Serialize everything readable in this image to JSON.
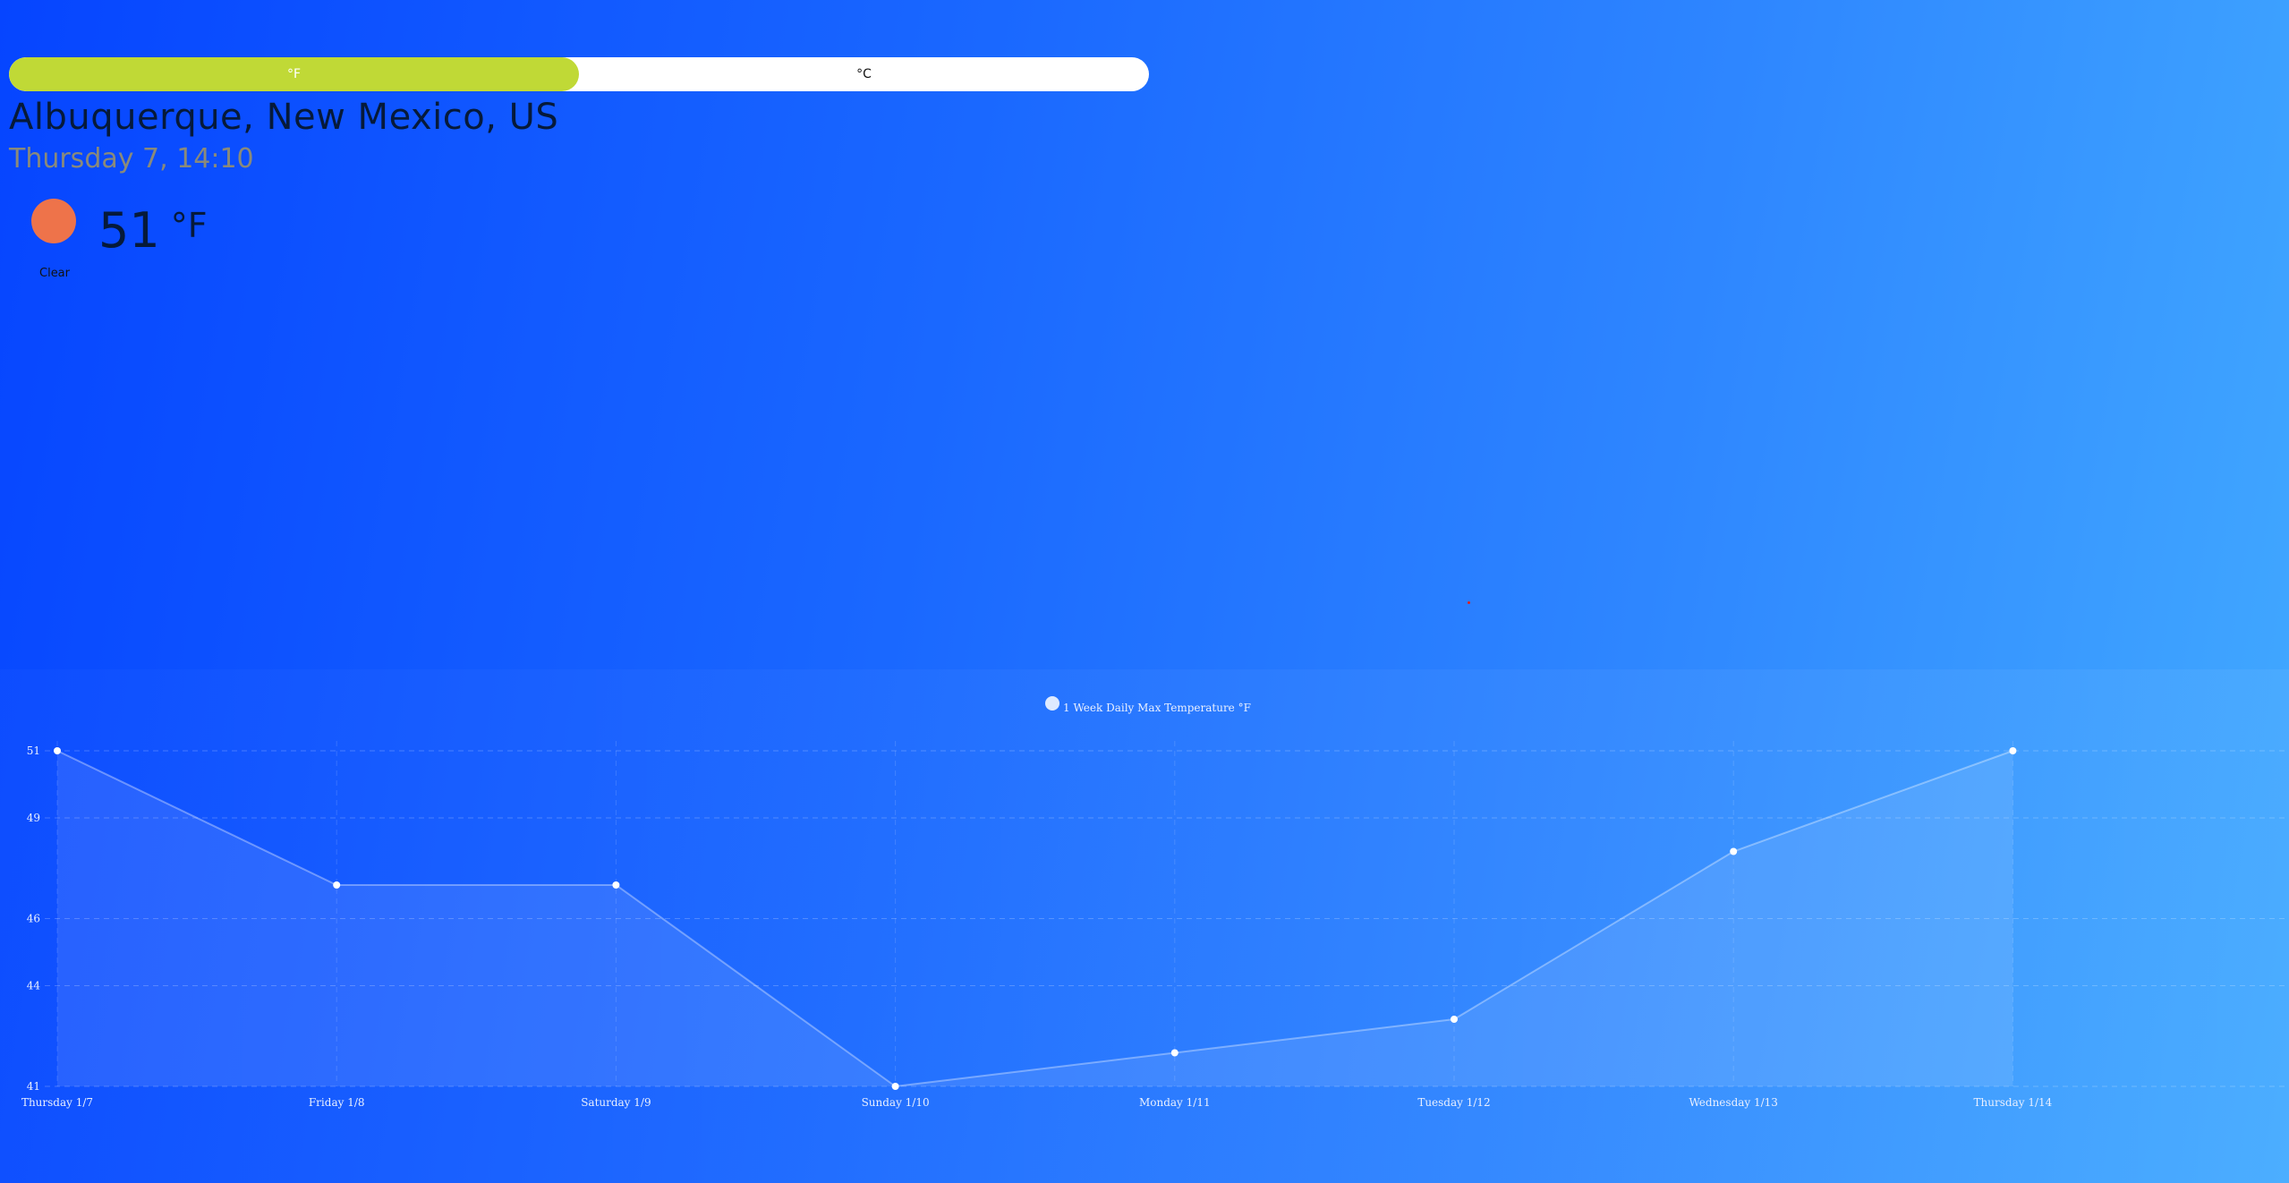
{
  "unit_toggle": {
    "fahrenheit": "°F",
    "celsius": "°C",
    "active": "fahrenheit"
  },
  "location": {
    "city": "Albuquerque, New Mexico, US",
    "datetime": "Thursday 7, 14:10"
  },
  "current": {
    "temp": "51",
    "unit": "°F",
    "condition": "Clear",
    "icon": "sun-icon"
  },
  "colors": {
    "accent": "#c0d936",
    "sun": "#ee734a",
    "background_start": "#0645ff",
    "background_end": "#42aaff"
  },
  "chart_data": {
    "type": "area",
    "title": "1 Week Daily Max Temperature °F",
    "legend": "1 Week Daily Max Temperature °F",
    "legend_position": "top-center",
    "categories": [
      "Thursday 1/7",
      "Friday 1/8",
      "Saturday 1/9",
      "Sunday 1/10",
      "Monday 1/11",
      "Tuesday 1/12",
      "Wednesday 1/13",
      "Thursday 1/14"
    ],
    "series": [
      {
        "name": "1 Week Daily Max Temperature °F",
        "values": [
          51,
          47,
          47,
          41,
          42,
          43,
          48,
          51
        ]
      }
    ],
    "yticks": [
      41,
      44,
      46,
      49,
      51
    ],
    "ylim": [
      41,
      51
    ],
    "grid": true
  }
}
